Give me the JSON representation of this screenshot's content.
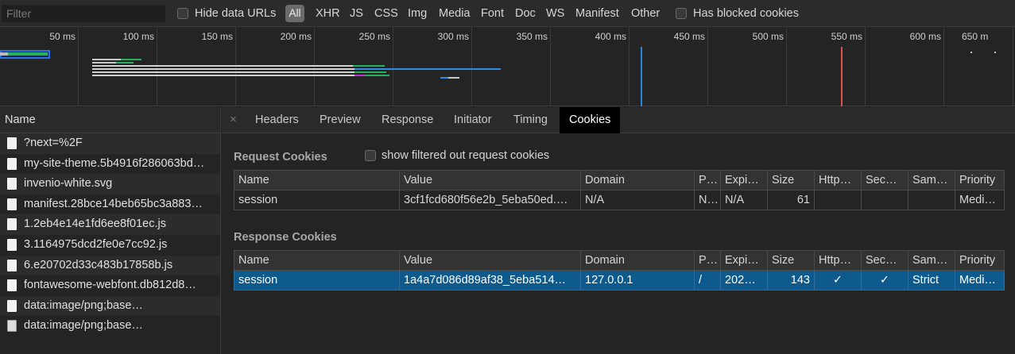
{
  "filterbar": {
    "placeholder": "Filter",
    "hide_data_urls": "Hide data URLs",
    "all": "All",
    "types": [
      "XHR",
      "JS",
      "CSS",
      "Img",
      "Media",
      "Font",
      "Doc",
      "WS",
      "Manifest",
      "Other"
    ],
    "has_blocked_cookies": "Has blocked cookies"
  },
  "timeline": {
    "ticks": [
      "50 ms",
      "100 ms",
      "150 ms",
      "200 ms",
      "250 ms",
      "300 ms",
      "350 ms",
      "400 ms",
      "450 ms",
      "500 ms",
      "550 ms",
      "600 ms",
      "650 m"
    ]
  },
  "requests": {
    "header": "Name",
    "items": [
      {
        "name": "?next=%2F",
        "icon": "document-icon"
      },
      {
        "name": "my-site-theme.5b4916f286063bd…",
        "icon": "document-icon"
      },
      {
        "name": "invenio-white.svg",
        "icon": "document-icon"
      },
      {
        "name": "manifest.28bce14beb65bc3a883…",
        "icon": "document-icon"
      },
      {
        "name": "1.2eb4e14e1fd6ee8f01ec.js",
        "icon": "document-icon"
      },
      {
        "name": "3.1164975dcd2fe0e7cc92.js",
        "icon": "document-icon"
      },
      {
        "name": "6.e20702d33c483b17858b.js",
        "icon": "document-icon"
      },
      {
        "name": "fontawesome-webfont.db812d8…",
        "icon": "document-icon"
      },
      {
        "name": "data:image/png;base…",
        "icon": "document-icon"
      },
      {
        "name": "data:image/png;base…",
        "icon": "image-icon"
      }
    ]
  },
  "detail": {
    "close": "×",
    "tabs": [
      "Headers",
      "Preview",
      "Response",
      "Initiator",
      "Timing",
      "Cookies"
    ],
    "active_tab": "Cookies",
    "request_title": "Request Cookies",
    "show_filtered": "show filtered out request cookies",
    "response_title": "Response Cookies",
    "columns": [
      "Name",
      "Value",
      "Domain",
      "P…",
      "Expi…",
      "Size",
      "Http…",
      "Sec…",
      "Sam…",
      "Priority"
    ],
    "request_rows": [
      [
        "session",
        "3cf1fcd680f56e2b_5eba50ed.…",
        "N/A",
        "N…",
        "N/A",
        "61",
        "",
        "",
        "",
        "Medi…"
      ]
    ],
    "response_rows": [
      [
        "session",
        "1a4a7d086d89af38_5eba514…",
        "127.0.0.1",
        "/",
        "202…",
        "143",
        "✓",
        "✓",
        "Strict",
        "Medi…"
      ]
    ]
  },
  "colors": {
    "selected_row": "#0e5a8c",
    "dom_content_loaded": "#2a86d8",
    "load": "#e05050"
  }
}
